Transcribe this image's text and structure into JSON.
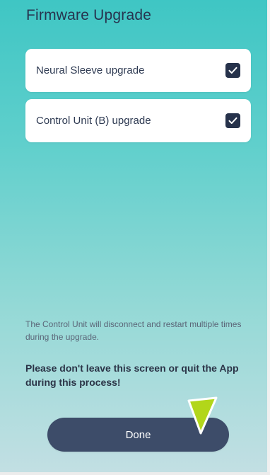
{
  "page": {
    "title": "Firmware Upgrade"
  },
  "options": [
    {
      "label": "Neural Sleeve upgrade",
      "checked": true
    },
    {
      "label": "Control Unit (B) upgrade",
      "checked": true
    }
  ],
  "footer": {
    "info": "The Control Unit will disconnect and restart multiple times during the upgrade.",
    "warning": "Please don't leave this screen or quit the App during this process!",
    "done_label": "Done"
  },
  "colors": {
    "background_top": "#3fc6c4",
    "background_bottom": "#c2dfe3",
    "title_text": "#27344f",
    "checkbox_fill": "#26324b",
    "button_fill": "#3d4c69",
    "pointer_green": "#b2d61a"
  },
  "icons": {
    "checkbox": "checkmark-icon",
    "pointer": "tap-pointer-icon"
  }
}
